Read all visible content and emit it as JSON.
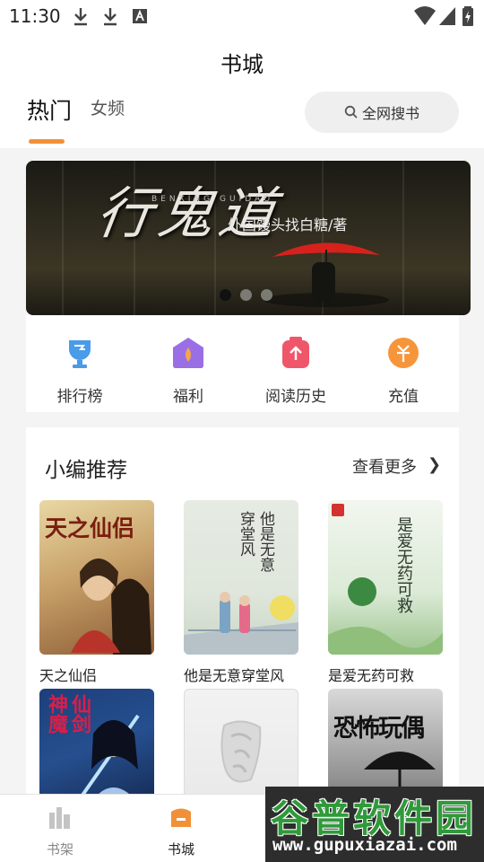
{
  "status_bar": {
    "time": "11:30"
  },
  "header": {
    "title": "书城"
  },
  "tabs": [
    {
      "label": "热门",
      "active": true
    },
    {
      "label": "女频",
      "active": false
    }
  ],
  "search": {
    "label": "全网搜书"
  },
  "banner": {
    "title": "行鬼道",
    "subtitle": "外国馒头找白糖/著",
    "pinyin": "BENXING GUIDAO",
    "pages": 3,
    "current_page": 1
  },
  "quick_links": [
    {
      "label": "排行榜",
      "icon": "trophy-icon",
      "color": "#4a9be8"
    },
    {
      "label": "福利",
      "icon": "gift-icon",
      "color": "#9a6fe6"
    },
    {
      "label": "阅读历史",
      "icon": "history-icon",
      "color": "#f0566a"
    },
    {
      "label": "充值",
      "icon": "recharge-icon",
      "color": "#f7953a"
    }
  ],
  "recommend": {
    "title": "小编推荐",
    "more_label": "查看更多",
    "books": [
      {
        "title": "天之仙侣",
        "cover_text": "天之仙侣"
      },
      {
        "title": "他是无意穿堂风",
        "cover_text": "他是无意穿堂风"
      },
      {
        "title": "是爱无药可救",
        "cover_text": "是爱无药可救"
      },
      {
        "title": "",
        "cover_text": "仙剑神魔"
      },
      {
        "title": "",
        "cover_text": ""
      },
      {
        "title": "",
        "cover_text": "恐怖玩偶"
      }
    ]
  },
  "bottom_nav": [
    {
      "label": "书架",
      "icon": "bookshelf-icon",
      "active": false
    },
    {
      "label": "书城",
      "icon": "bookstore-icon",
      "active": true
    }
  ],
  "watermark": {
    "line1": "谷普软件园",
    "line2": "www.gupuxiazai.com"
  },
  "colors": {
    "accent": "#f0913a",
    "page_bg": "#f4f4f4"
  }
}
